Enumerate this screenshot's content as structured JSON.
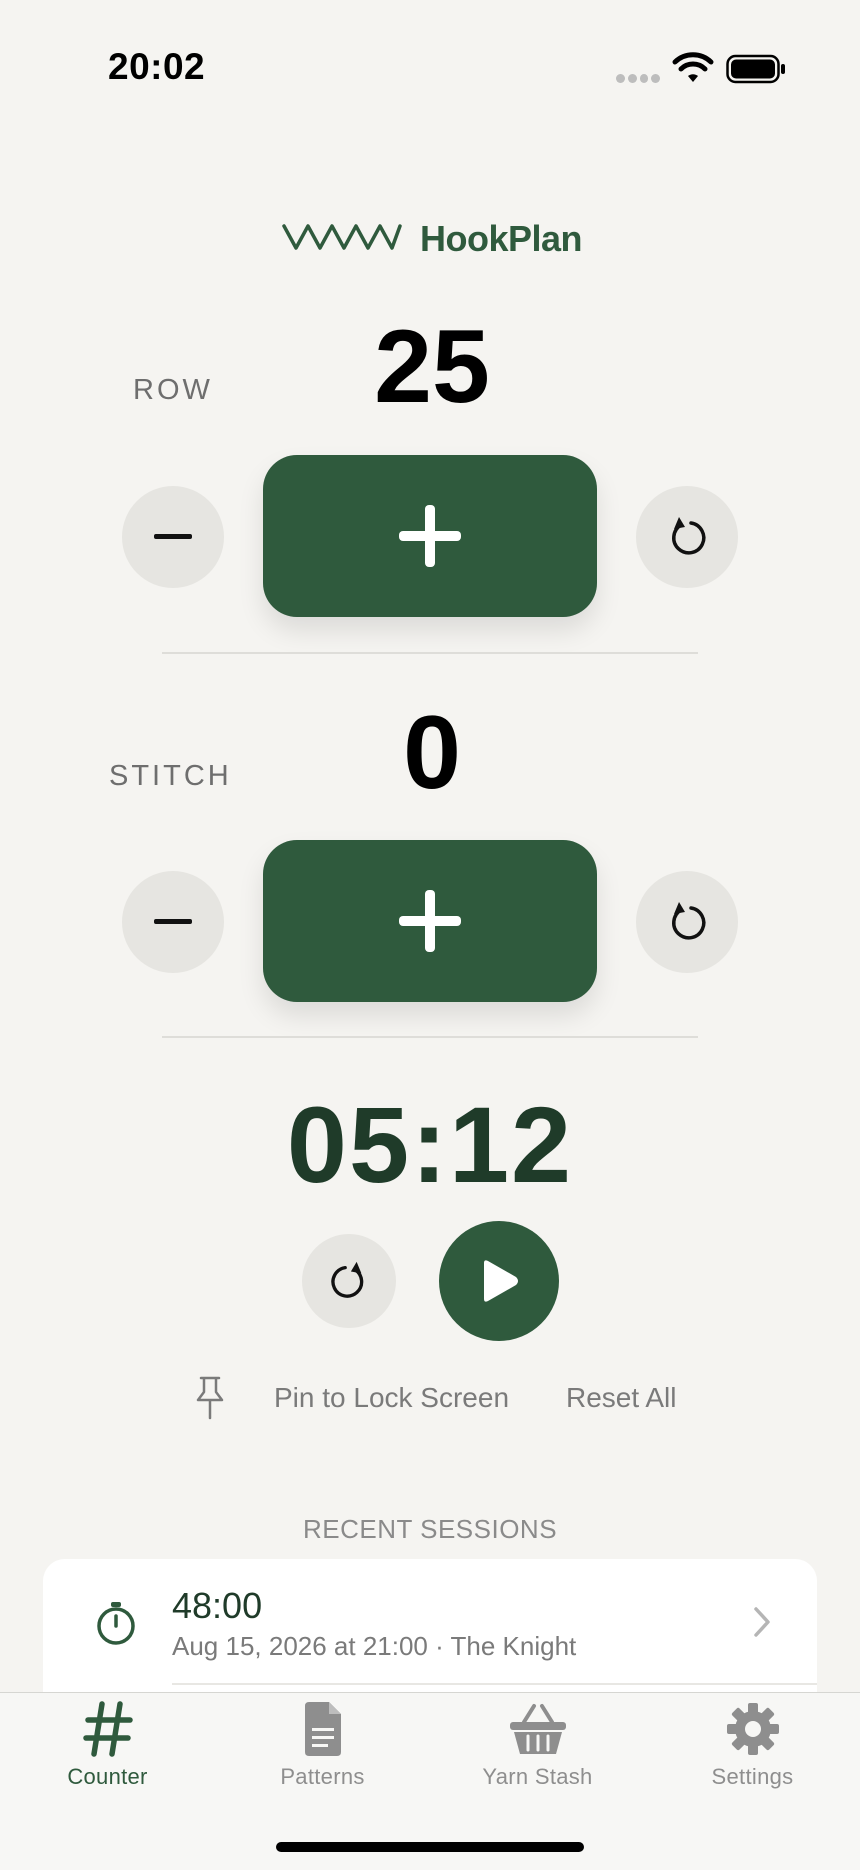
{
  "status_bar": {
    "time": "20:02"
  },
  "app": {
    "name": "HookPlan",
    "accent": "#2F5A3D"
  },
  "row_counter": {
    "label": "ROW",
    "value": "25"
  },
  "stitch_counter": {
    "label": "STITCH",
    "value": "0"
  },
  "timer": {
    "value": "05:12"
  },
  "actions": {
    "pin_label": "Pin to Lock Screen",
    "reset_all_label": "Reset All"
  },
  "recent_sessions": {
    "title": "RECENT SESSIONS",
    "items": [
      {
        "duration": "48:00",
        "detail": "Aug 15, 2026 at 21:00 · The Knight",
        "icon": "stopwatch-icon"
      }
    ]
  },
  "tabs": [
    {
      "label": "Counter",
      "icon": "hash-icon",
      "active": true
    },
    {
      "label": "Patterns",
      "icon": "document-icon",
      "active": false
    },
    {
      "label": "Yarn Stash",
      "icon": "basket-icon",
      "active": false
    },
    {
      "label": "Settings",
      "icon": "gear-icon",
      "active": false
    }
  ]
}
